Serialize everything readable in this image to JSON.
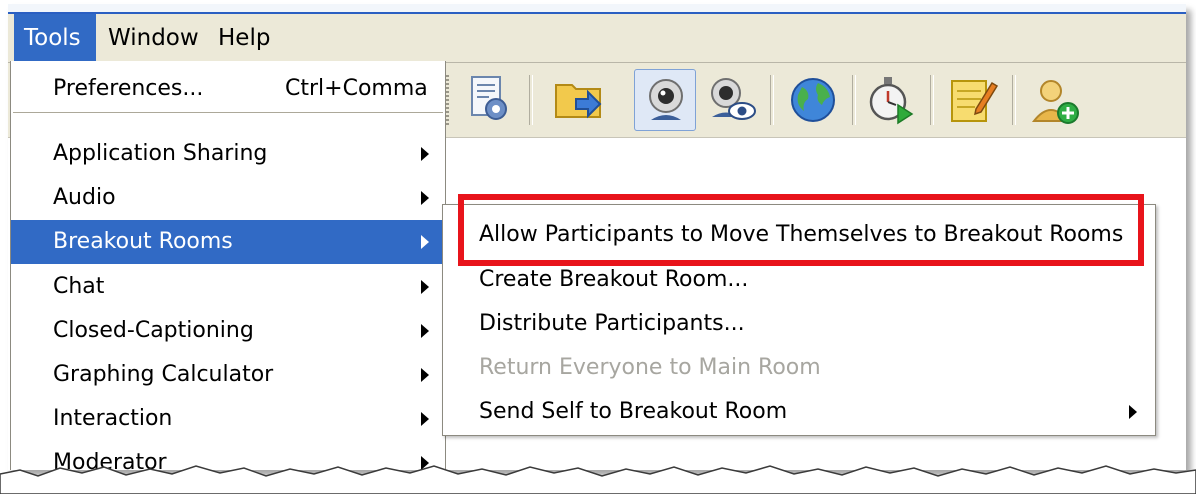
{
  "menubar": {
    "items": [
      {
        "label": "Tools"
      },
      {
        "label": "Window"
      },
      {
        "label": "Help"
      }
    ]
  },
  "toolbar": {
    "icons": [
      "document-settings-icon",
      "folder-arrow-icon",
      "webcam-icon",
      "webcam-view-icon",
      "globe-icon",
      "stopwatch-play-icon",
      "notepad-edit-icon",
      "add-user-icon"
    ]
  },
  "tools_menu": {
    "preferences": {
      "label": "Preferences...",
      "shortcut": "Ctrl+Comma"
    },
    "items": [
      {
        "label": "Application Sharing"
      },
      {
        "label": "Audio"
      },
      {
        "label": "Breakout Rooms"
      },
      {
        "label": "Chat"
      },
      {
        "label": "Closed-Captioning"
      },
      {
        "label": "Graphing Calculator"
      },
      {
        "label": "Interaction"
      },
      {
        "label": "Moderator"
      }
    ],
    "highlighted": "Breakout Rooms"
  },
  "breakout_submenu": {
    "items": [
      {
        "label": "Allow Participants to Move Themselves to Breakout Rooms",
        "enabled": true
      },
      {
        "label": "Create Breakout Room...",
        "enabled": true
      },
      {
        "label": "Distribute Participants...",
        "enabled": true
      },
      {
        "label": "Return Everyone to Main Room",
        "enabled": false
      },
      {
        "label": "Send Self to Breakout Room",
        "enabled": true
      }
    ]
  },
  "colors": {
    "highlight": "#316ac5",
    "callout_box": "#e8141b",
    "menubar_bg": "#ece9d8",
    "disabled_text": "#a7a6a0"
  }
}
